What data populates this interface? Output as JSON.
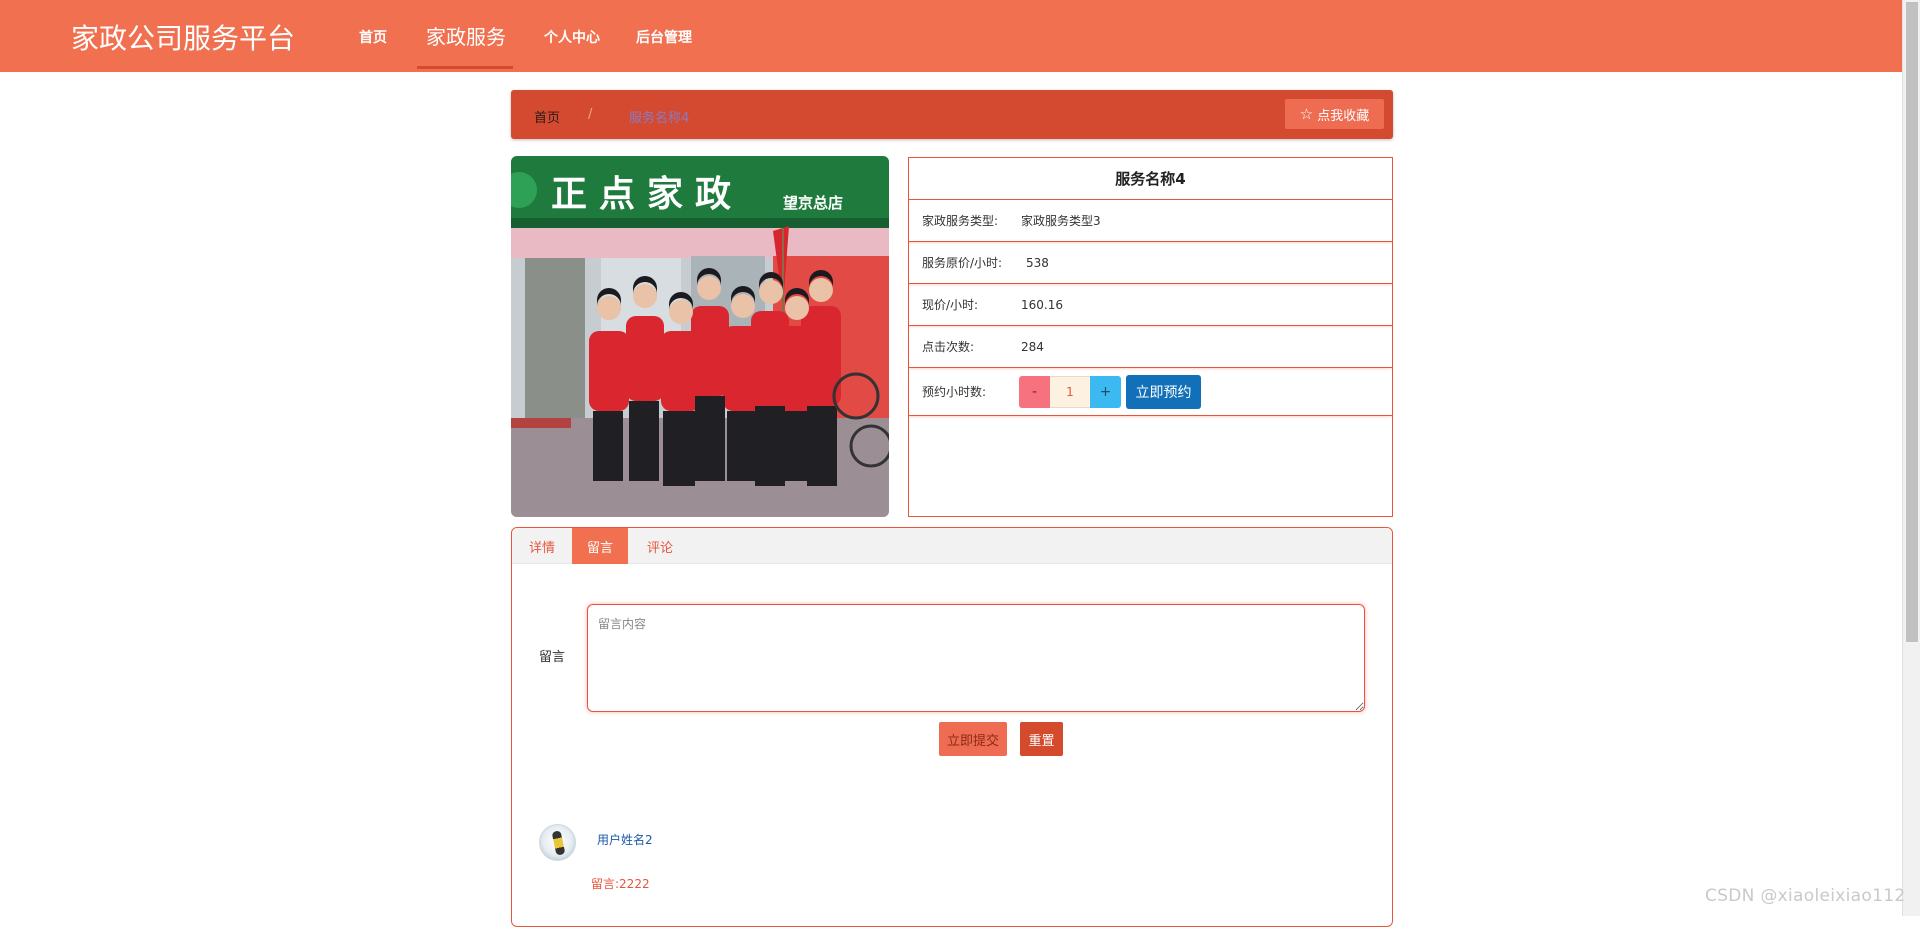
{
  "brand": "家政公司服务平台",
  "nav": {
    "items": [
      {
        "label": "首页"
      },
      {
        "label": "家政服务"
      },
      {
        "label": "个人中心"
      },
      {
        "label": "后台管理"
      }
    ],
    "active": "家政服务"
  },
  "breadcrumb": {
    "home": "首页",
    "separator": "/",
    "current": "服务名称4"
  },
  "favorite_button": {
    "icon": "star-outline-icon",
    "label": "点我收藏"
  },
  "service": {
    "name": "服务名称4",
    "rows": [
      {
        "label": "家政服务类型:",
        "value": "家政服务类型3"
      },
      {
        "label": "服务原价/小时:",
        "value": "538"
      },
      {
        "label": "现价/小时:",
        "value": "160.16"
      },
      {
        "label": "点击次数:",
        "value": "284"
      }
    ],
    "booking": {
      "label": "预约小时数:",
      "minus": "-",
      "quantity": "1",
      "plus": "+",
      "button": "立即预约"
    }
  },
  "tabs": [
    {
      "label": "详情"
    },
    {
      "label": "留言"
    },
    {
      "label": "评论"
    }
  ],
  "active_tab": "留言",
  "message_form": {
    "label": "留言",
    "placeholder": "留言内容",
    "submit": "立即提交",
    "reset": "重置"
  },
  "messages": [
    {
      "user": "用户姓名2",
      "text": "留言:2222"
    }
  ],
  "watermark": "CSDN @xiaoleixiao112",
  "colors": {
    "primary": "#f07050",
    "dark_primary": "#d44a30",
    "border": "#e8553b",
    "book_button": "#1170b8",
    "plus_button": "#3bb9f0",
    "minus_button": "#f7727f"
  }
}
